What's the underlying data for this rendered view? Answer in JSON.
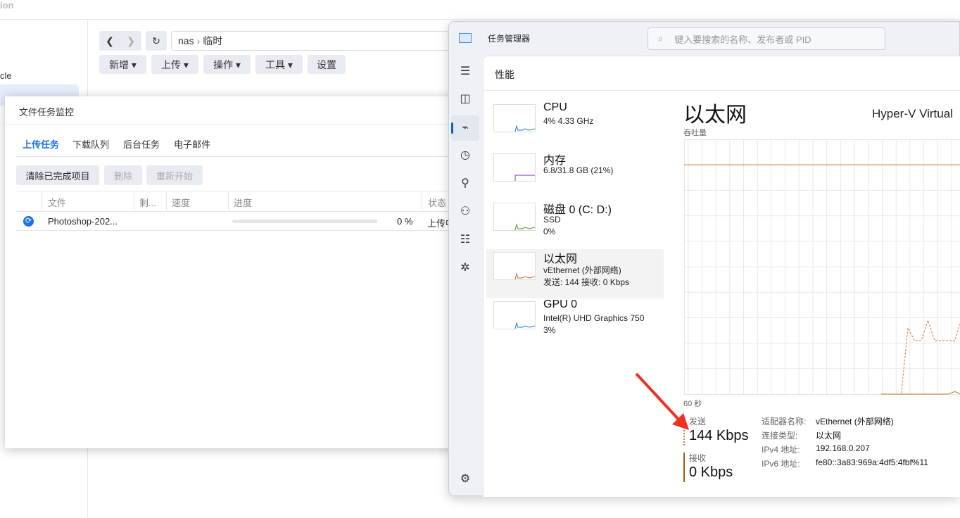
{
  "file_station": {
    "title_fragment": "ion",
    "sidebar_fragment": "cle",
    "path": {
      "root": "nas",
      "sep": "›",
      "folder": "临时"
    },
    "toolbar": [
      "新增 ▾",
      "上传 ▾",
      "操作 ▾",
      "工具 ▾",
      "设置"
    ]
  },
  "task_dialog": {
    "title": "文件任务监控",
    "tabs": [
      "上传任务",
      "下载队列",
      "后台任务",
      "电子邮件"
    ],
    "active_tab": 0,
    "buttons": [
      "清除已完成项目",
      "删除",
      "重新开始"
    ],
    "columns": [
      "文件",
      "剩...",
      "速度",
      "进度",
      "状态"
    ],
    "rows": [
      {
        "file": "Photoshop-202...",
        "remaining": "",
        "speed": "",
        "progress": 0,
        "progress_text": "0 %",
        "status": "上传中"
      }
    ],
    "accent": "#1a73e8"
  },
  "task_manager": {
    "title": "任务管理器",
    "search_placeholder": "键入要搜索的名称、发布者或 PID",
    "page_title": "性能",
    "nav_icons": [
      "hamburger-icon",
      "processes-icon",
      "performance-icon",
      "history-icon",
      "startup-icon",
      "users-icon",
      "details-icon",
      "services-icon",
      "settings-icon"
    ],
    "items": [
      {
        "name": "CPU",
        "line2": "4% 4.33 GHz",
        "line3": "",
        "color": "#1f7ac8"
      },
      {
        "name": "内存",
        "line2": "6.8/31.8 GB (21%)",
        "line3": "",
        "color": "#8e2cb4"
      },
      {
        "name": "磁盘 0 (C: D:)",
        "line2": "SSD",
        "line3": "0%",
        "color": "#4a9a2a"
      },
      {
        "name": "以太网",
        "line2": "vEthernet (外部网络)",
        "line3": "发送: 144 接收: 0 Kbps",
        "color": "#c8612a"
      },
      {
        "name": "GPU 0",
        "line2": "Intel(R) UHD Graphics 750",
        "line3": "3%",
        "color": "#1f7ac8"
      }
    ],
    "selected_item": 3,
    "detail": {
      "title": "以太网",
      "adapter_title": "Hyper-V Virtual",
      "graph_label": "吞吐量",
      "time_label": "60 秒",
      "send_label": "发送",
      "send_value": "144 Kbps",
      "recv_label": "接收",
      "recv_value": "0 Kbps",
      "props": [
        {
          "k": "适配器名称:",
          "v": "vEthernet (外部网络)"
        },
        {
          "k": "连接类型:",
          "v": "以太网"
        },
        {
          "k": "IPv4 地址:",
          "v": "192.168.0.207"
        },
        {
          "k": "IPv6 地址:",
          "v": "fe80::3a83:969a:4df5:4fbf%11"
        }
      ]
    },
    "chart_data": {
      "type": "line",
      "xlabel": "60 秒",
      "ylabel": "吞吐量",
      "grid": true,
      "series": [
        {
          "name": "发送",
          "style": "dashed",
          "color": "#e07030",
          "values": [
            0,
            0,
            0,
            0,
            26,
            21,
            21,
            29,
            21,
            21,
            21,
            21,
            29
          ]
        },
        {
          "name": "接收",
          "style": "solid",
          "color": "#c07830",
          "values": [
            0,
            0,
            0,
            0,
            0,
            0,
            0,
            0,
            0,
            0,
            0,
            1,
            0
          ]
        }
      ],
      "max_line_fraction": 0.9
    }
  },
  "annotation": {
    "arrow_color": "#f03020"
  }
}
